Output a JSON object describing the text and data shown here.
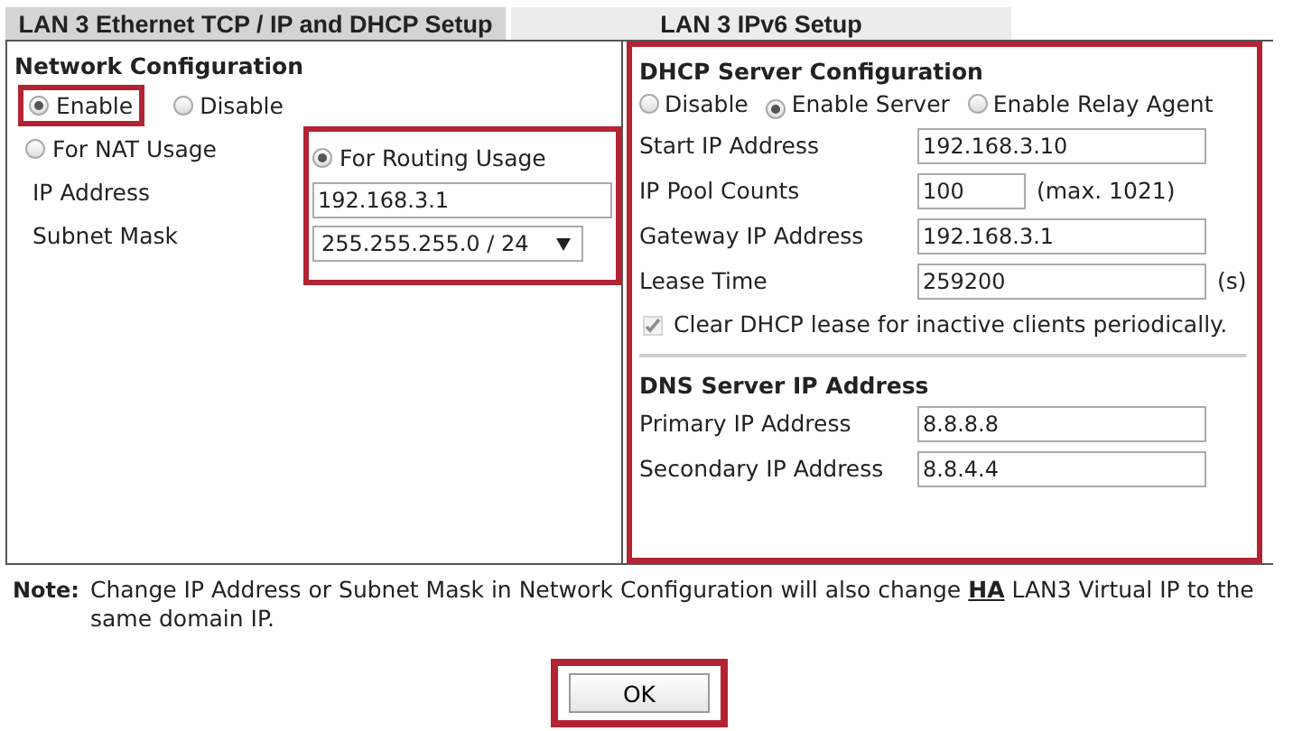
{
  "tabs": [
    {
      "label": "LAN 3 Ethernet TCP / IP and DHCP Setup",
      "selected": true
    },
    {
      "label": "LAN 3 IPv6 Setup",
      "selected": false
    }
  ],
  "network_configuration": {
    "title": "Network Configuration",
    "mode_options": [
      {
        "label": "Enable",
        "selected": true,
        "highlighted": true
      },
      {
        "label": "Disable",
        "selected": false,
        "highlighted": false
      }
    ],
    "usage_options": [
      {
        "label": "For NAT Usage",
        "selected": false
      },
      {
        "label": "For Routing Usage",
        "selected": true
      }
    ],
    "routing_highlighted": true,
    "ip_address": {
      "label": "IP Address",
      "value": "192.168.3.1"
    },
    "subnet_mask": {
      "label": "Subnet Mask",
      "value": "255.255.255.0 / 24"
    }
  },
  "dhcp_server": {
    "title": "DHCP Server Configuration",
    "highlighted": true,
    "options": [
      {
        "label": "Disable",
        "selected": false
      },
      {
        "label": "Enable Server",
        "selected": true
      },
      {
        "label": "Enable Relay Agent",
        "selected": false
      }
    ],
    "fields": [
      {
        "label": "Start IP Address",
        "value": "192.168.3.10",
        "kind": "long"
      },
      {
        "label": "IP Pool Counts",
        "value": "100",
        "suffix": "(max. 1021)",
        "kind": "short"
      },
      {
        "label": "Gateway IP Address",
        "value": "192.168.3.1",
        "kind": "long"
      },
      {
        "label": "Lease Time",
        "value": "259200",
        "suffix": "(s)",
        "kind": "long"
      }
    ],
    "clear_lease": {
      "label": "Clear DHCP lease for inactive clients periodically.",
      "checked": true,
      "disabled": true
    }
  },
  "dns_server": {
    "title": "DNS Server IP Address",
    "fields": [
      {
        "label": "Primary IP Address",
        "value": "8.8.8.8"
      },
      {
        "label": "Secondary IP Address",
        "value": "8.8.4.4"
      }
    ]
  },
  "note": {
    "label": "Note:",
    "text_before": "Change IP Address or Subnet Mask in Network Configuration will also change ",
    "link": "HA",
    "text_after": " LAN3 Virtual IP to the same domain IP."
  },
  "ok_button": {
    "label": "OK",
    "highlighted": true
  }
}
